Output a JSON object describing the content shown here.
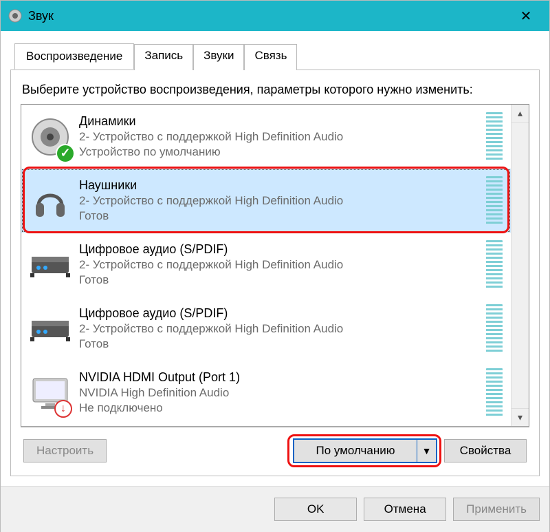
{
  "window": {
    "title": "Звук",
    "close_symbol": "✕"
  },
  "tabs": [
    "Воспроизведение",
    "Запись",
    "Звуки",
    "Связь"
  ],
  "active_tab_index": 0,
  "instruction": "Выберите устройство воспроизведения, параметры которого нужно изменить:",
  "devices": [
    {
      "name": "Динамики",
      "sub": "2- Устройство с поддержкой High Definition Audio",
      "status": "Устройство по умолчанию",
      "icon": "speaker",
      "badge": "check",
      "selected": false
    },
    {
      "name": "Наушники",
      "sub": "2- Устройство с поддержкой High Definition Audio",
      "status": "Готов",
      "icon": "headphones",
      "badge": null,
      "selected": true
    },
    {
      "name": "Цифровое аудио (S/PDIF)",
      "sub": "2- Устройство с поддержкой High Definition Audio",
      "status": "Готов",
      "icon": "receiver",
      "badge": null,
      "selected": false
    },
    {
      "name": "Цифровое аудио (S/PDIF)",
      "sub": "2- Устройство с поддержкой High Definition Audio",
      "status": "Готов",
      "icon": "receiver",
      "badge": null,
      "selected": false
    },
    {
      "name": "NVIDIA HDMI Output (Port 1)",
      "sub": "NVIDIA High Definition Audio",
      "status": "Не подключено",
      "icon": "monitor",
      "badge": "down",
      "selected": false
    }
  ],
  "buttons": {
    "configure": "Настроить",
    "set_default": "По умолчанию",
    "properties": "Свойства",
    "ok": "OK",
    "cancel": "Отмена",
    "apply": "Применить"
  },
  "annotations": {
    "highlight_device_index": 1,
    "highlight_default_button": true
  }
}
